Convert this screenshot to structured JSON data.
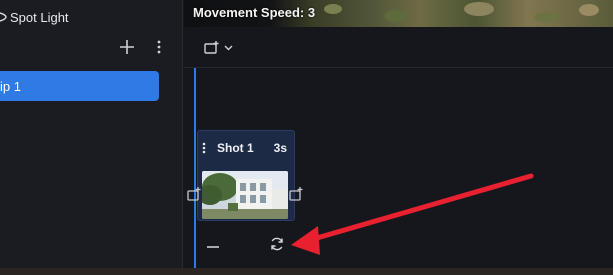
{
  "left_panel": {
    "title": "Spot Light",
    "icons": {
      "title": "light-icon",
      "add": "plus-icon",
      "more": "more-vertical-icon"
    },
    "clip_label": "ip 1"
  },
  "preview": {
    "speed_text": "Movement Speed: 3"
  },
  "toolbar": {
    "icons": {
      "add_shot": "add-shot-icon",
      "dropdown": "chevron-down-icon"
    }
  },
  "timeline": {
    "shot": {
      "name": "Shot 1",
      "duration": "3s"
    },
    "icons": {
      "insert_left": "insert-shot-icon",
      "insert_right": "insert-shot-icon",
      "zoom_out": "minus-icon",
      "refresh": "refresh-icon"
    }
  },
  "annotation": {
    "arrow_color": "#e8202f"
  },
  "colors": {
    "accent": "#2f7ae5",
    "panel": "#1b1c22",
    "background": "#16171d",
    "shot_card": "#1d2a45"
  }
}
